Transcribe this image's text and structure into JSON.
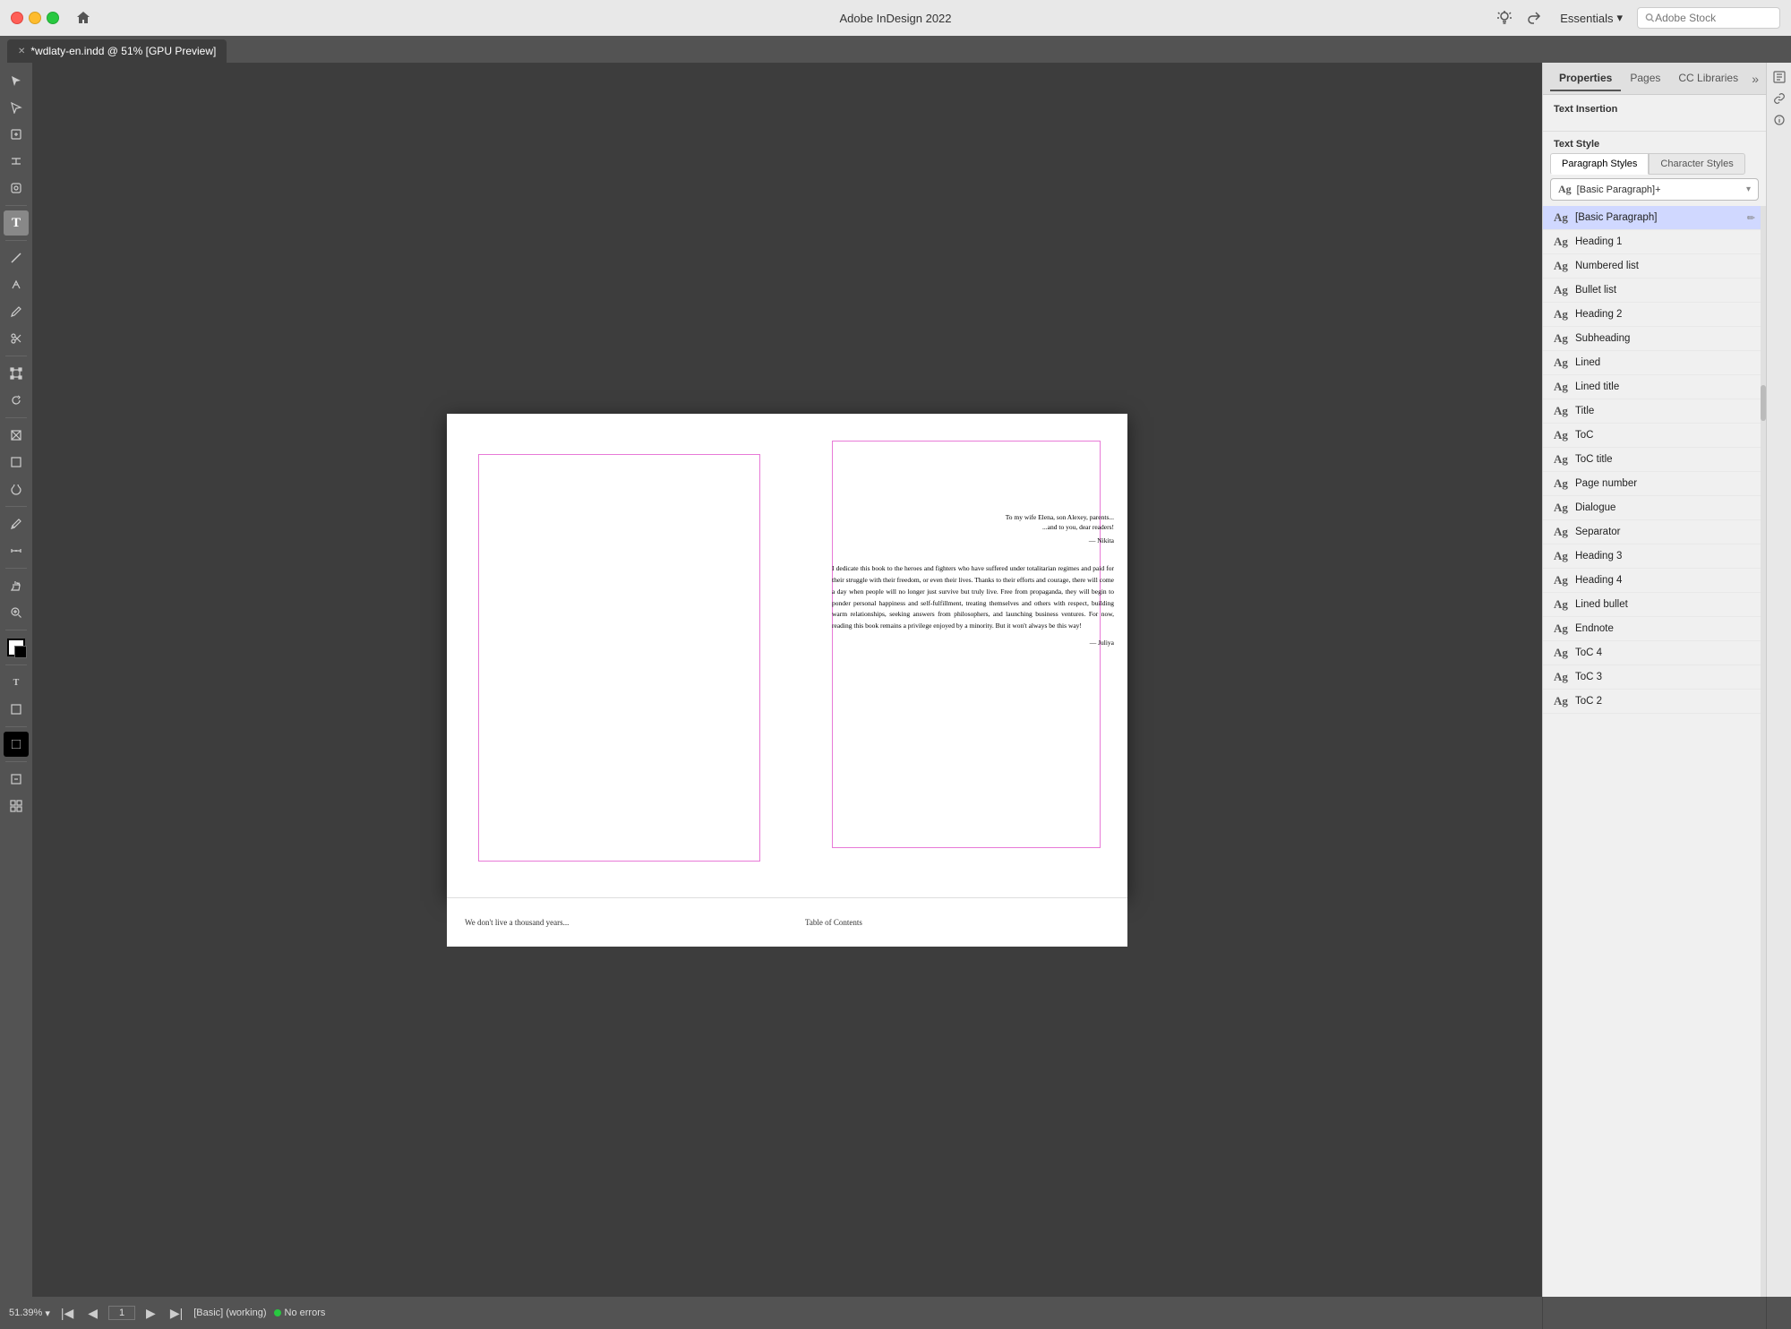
{
  "app": {
    "title": "Adobe InDesign 2022",
    "workspace": "Essentials",
    "search_placeholder": "Adobe Stock"
  },
  "titlebar": {
    "traffic": [
      "close",
      "minimize",
      "maximize"
    ],
    "tab_label": "*wdlaty-en.indd @ 51% [GPU Preview]",
    "collapse_label": "«"
  },
  "toolbar": {
    "tools": [
      {
        "name": "selection-tool",
        "icon": "↖",
        "label": "Selection"
      },
      {
        "name": "direct-selection-tool",
        "icon": "↗",
        "label": "Direct Selection"
      },
      {
        "name": "page-tool",
        "icon": "⊞",
        "label": "Page"
      },
      {
        "name": "gap-tool",
        "icon": "⊟",
        "label": "Gap"
      },
      {
        "name": "content-collector-tool",
        "icon": "⊕",
        "label": "Content Collector"
      },
      {
        "name": "type-tool",
        "icon": "T",
        "label": "Type",
        "active": true
      },
      {
        "name": "line-tool",
        "icon": "╱",
        "label": "Line"
      },
      {
        "name": "pen-tool",
        "icon": "✒",
        "label": "Pen"
      },
      {
        "name": "pencil-tool",
        "icon": "✏",
        "label": "Pencil"
      },
      {
        "name": "scissors-tool",
        "icon": "✂",
        "label": "Scissors"
      },
      {
        "name": "free-transform-tool",
        "icon": "⊠",
        "label": "Free Transform"
      },
      {
        "name": "rotate-tool",
        "icon": "↻",
        "label": "Rotate"
      },
      {
        "name": "rectangle-frame-tool",
        "icon": "⊡",
        "label": "Rectangle Frame"
      },
      {
        "name": "rectangle-tool",
        "icon": "□",
        "label": "Rectangle"
      },
      {
        "name": "pathfinder-tool",
        "icon": "⊗",
        "label": "Pathfinder"
      },
      {
        "name": "color-theme-tool",
        "icon": "◈",
        "label": "Color Theme"
      },
      {
        "name": "eyedropper-tool",
        "icon": "⊘",
        "label": "Eyedropper"
      },
      {
        "name": "measure-tool",
        "icon": "⊖",
        "label": "Measure"
      },
      {
        "name": "hand-tool",
        "icon": "✋",
        "label": "Hand"
      },
      {
        "name": "zoom-tool",
        "icon": "⊕",
        "label": "Zoom"
      }
    ]
  },
  "canvas": {
    "page_content": {
      "dedication_line1": "To my wife Elena, son Alexey, parents...",
      "dedication_line2": "...and to you, dear readers!",
      "dedication_sig1": "— Nikita",
      "body_text": "I dedicate this book to the heroes and fighters who have suffered under totalitarian regimes and paid for their struggle with their freedom, or even their lives. Thanks to their efforts and courage, there will come a day when people will no longer just survive but truly live. Free from propaganda, they will begin to ponder personal happiness and self-fulfillment, treating themselves and others with respect, building warm relationships, seeking answers from philosophers, and launching business ventures. For now, reading this book remains a privilege enjoyed by a minority. But it won't always be this way!",
      "dedication_sig2": "— Juliya"
    }
  },
  "right_panel": {
    "tabs": [
      {
        "label": "Properties",
        "active": true
      },
      {
        "label": "Pages"
      },
      {
        "label": "CC Libraries"
      }
    ],
    "expand_icon": "»",
    "text_insertion_label": "Text Insertion",
    "text_style_label": "Text Style",
    "style_tabs": [
      {
        "label": "Paragraph Styles",
        "active": true
      },
      {
        "label": "Character Styles"
      }
    ],
    "current_style": {
      "ag": "Ag",
      "name": "[Basic Paragraph]+"
    },
    "styles": [
      {
        "ag": "Ag",
        "name": "[Basic Paragraph]",
        "selected": true,
        "editable": true
      },
      {
        "ag": "Ag",
        "name": "Heading 1"
      },
      {
        "ag": "Ag",
        "name": "Numbered list"
      },
      {
        "ag": "Ag",
        "name": "Bullet list"
      },
      {
        "ag": "Ag",
        "name": "Heading 2"
      },
      {
        "ag": "Ag",
        "name": "Subheading"
      },
      {
        "ag": "Ag",
        "name": "Lined"
      },
      {
        "ag": "Ag",
        "name": "Lined title"
      },
      {
        "ag": "Ag",
        "name": "Title"
      },
      {
        "ag": "Ag",
        "name": "ToC"
      },
      {
        "ag": "Ag",
        "name": "ToC title"
      },
      {
        "ag": "Ag",
        "name": "Page number"
      },
      {
        "ag": "Ag",
        "name": "Dialogue"
      },
      {
        "ag": "Ag",
        "name": "Separator"
      },
      {
        "ag": "Ag",
        "name": "Heading 3"
      },
      {
        "ag": "Ag",
        "name": "Heading 4"
      },
      {
        "ag": "Ag",
        "name": "Lined bullet"
      },
      {
        "ag": "Ag",
        "name": "Endnote"
      },
      {
        "ag": "Ag",
        "name": "ToC 4"
      },
      {
        "ag": "Ag",
        "name": "ToC 3"
      },
      {
        "ag": "Ag",
        "name": "ToC 2"
      }
    ]
  },
  "bottom_bar": {
    "zoom_level": "51.39%",
    "page_number": "1",
    "style_label": "[Basic] (working)",
    "status_label": "No errors"
  },
  "bottom_strip": {
    "left_text": "We don't live a thousand years...",
    "right_text": "Table of Contents"
  }
}
